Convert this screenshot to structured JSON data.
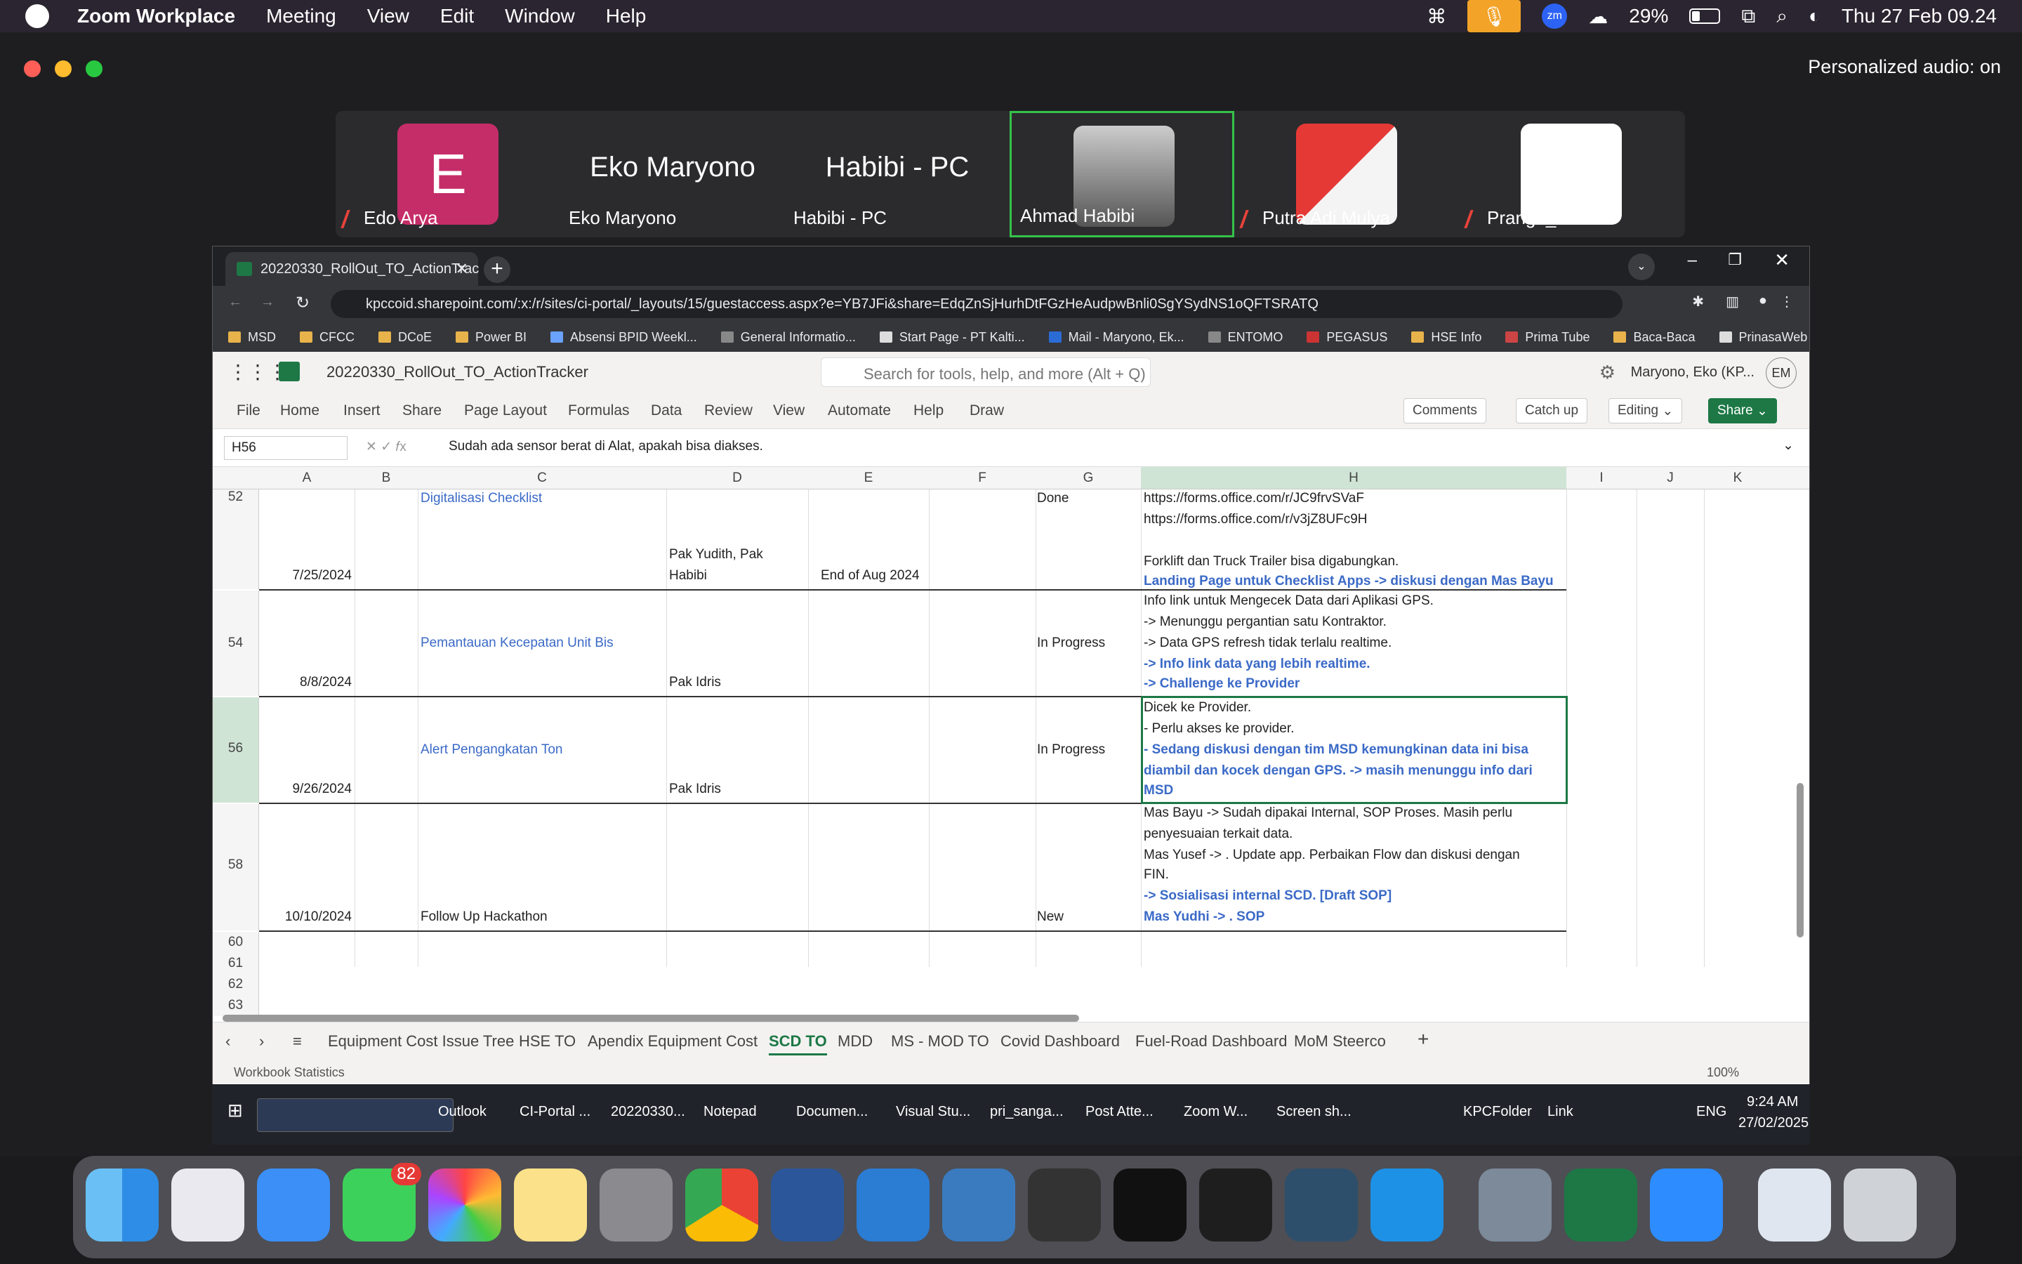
{
  "menubar": {
    "app": "Zoom Workplace",
    "items": [
      "Meeting",
      "View",
      "Edit",
      "Window",
      "Help"
    ],
    "battery": "29%",
    "datetime": "Thu 27 Feb 09.24"
  },
  "zoom": {
    "personalized_audio": "Personalized audio: on",
    "participants": [
      {
        "name": "Edo Arya",
        "initial": "E"
      },
      {
        "name": "Eko Maryono",
        "big": "Eko Maryono"
      },
      {
        "name": "Habibi - PC",
        "big": "Habibi - PC"
      },
      {
        "name": "Ahmad Habibi"
      },
      {
        "name": "Putra Adi Mulya"
      },
      {
        "name": "Pranga_KPC"
      }
    ]
  },
  "browser": {
    "tab_title": "20220330_RollOut_TO_ActionTrac",
    "url": "kpccoid.sharepoint.com/:x:/r/sites/ci-portal/_layouts/15/guestaccess.aspx?e=YB7JFi&share=EdqZnSjHurhDtFGzHeAudpwBnli0SgYSydNS1oQFTSRATQ",
    "bookmarks": [
      "MSD",
      "CFCC",
      "DCoE",
      "Power BI",
      "Absensi BPID Weekl...",
      "General Informatio...",
      "Start Page - PT Kalti...",
      "Mail - Maryono, Ek...",
      "ENTOMO",
      "PEGASUS",
      "HSE Info",
      "Prima Tube",
      "Baca-Baca",
      "PrinasaWeb"
    ]
  },
  "excel": {
    "file": "20220330_RollOut_TO_ActionTracker",
    "search": "Search for tools, help, and more (Alt + Q)",
    "user": "Maryono, Eko (KP...",
    "user_initials": "EM",
    "ribbon": [
      "File",
      "Home",
      "Insert",
      "Share",
      "Page Layout",
      "Formulas",
      "Data",
      "Review",
      "View",
      "Automate",
      "Help",
      "Draw"
    ],
    "comments": "Comments",
    "catchup": "Catch up",
    "editing": "Editing",
    "share": "Share",
    "namebox": "H56",
    "formula": "Sudah ada sensor berat di Alat, apakah bisa diakses.",
    "columns": [
      "A",
      "B",
      "C",
      "D",
      "E",
      "F",
      "G",
      "H",
      "I",
      "J",
      "K"
    ],
    "rows": {
      "r52": {
        "num": "52",
        "A": "7/25/2024",
        "C": "Digitalisasi Checklist",
        "D1": "Pak Yudith, Pak",
        "D2": "Habibi",
        "E": "End of Aug 2024",
        "G": "Done",
        "H": [
          "https://forms.office.com/r/JC9frvSVaF",
          "https://forms.office.com/r/v3jZ8UFc9H",
          "",
          "Forklift dan Truck Trailer bisa digabungkan.",
          "Landing Page untuk Checklist Apps -> diskusi dengan Mas Bayu"
        ]
      },
      "r54": {
        "num": "54",
        "A": "8/8/2024",
        "C": "Pemantauan Kecepatan Unit Bis",
        "D": "Pak Idris",
        "G": "In Progress",
        "H": [
          "Info link untuk Mengecek Data dari Aplikasi GPS.",
          "-> Menunggu pergantian satu Kontraktor.",
          "-> Data GPS refresh tidak terlalu realtime.",
          "-> Info link data yang lebih realtime.",
          "-> Challenge ke Provider"
        ]
      },
      "r56": {
        "num": "56",
        "A": "9/26/2024",
        "C": "Alert Pengangkatan Ton",
        "D": "Pak Idris",
        "G": "In Progress",
        "H": [
          "Dicek ke Provider.",
          " - Perlu akses ke provider.",
          "- Sedang diskusi dengan tim MSD kemungkinan data ini bisa",
          "diambil dan kocek dengan GPS. -> masih menunggu info dari",
          "MSD"
        ]
      },
      "r58": {
        "num": "58",
        "A": "10/10/2024",
        "C": "Follow Up Hackathon",
        "G": "New",
        "H": [
          "Mas Bayu -> Sudah dipakai Internal, SOP Proses. Masih perlu",
          "penyesuaian terkait data.",
          "Mas Yusef -> . Update app. Perbaikan Flow dan diskusi dengan",
          "FIN.",
          "-> Sosialisasi internal SCD. [Draft SOP]",
          "Mas Yudhi -> . SOP"
        ]
      },
      "empty": [
        "60",
        "61",
        "62",
        "63"
      ]
    },
    "sheets": [
      "Equipment Cost Issue Tree",
      "HSE TO",
      "Apendix Equipment Cost",
      "SCD TO",
      "MDD",
      "MS - MOD TO",
      "Covid Dashboard",
      "Fuel-Road Dashboard",
      "MoM Steerco"
    ],
    "active_sheet": "SCD TO",
    "status_left": "Workbook Statistics",
    "zoom": "100%"
  },
  "wintaskbar": {
    "items": [
      "Outlook",
      "CI-Portal ...",
      "20220330...",
      "Notepad",
      "Documen...",
      "Visual Stu...",
      "pri_sanga...",
      "Post Atte...",
      "Zoom W...",
      "Screen sh..."
    ],
    "tray": [
      "KPCFolder",
      "Link",
      "ENG"
    ],
    "time": "9:24 AM",
    "date": "27/02/2025"
  },
  "dock": {
    "messages_badge": "82"
  }
}
